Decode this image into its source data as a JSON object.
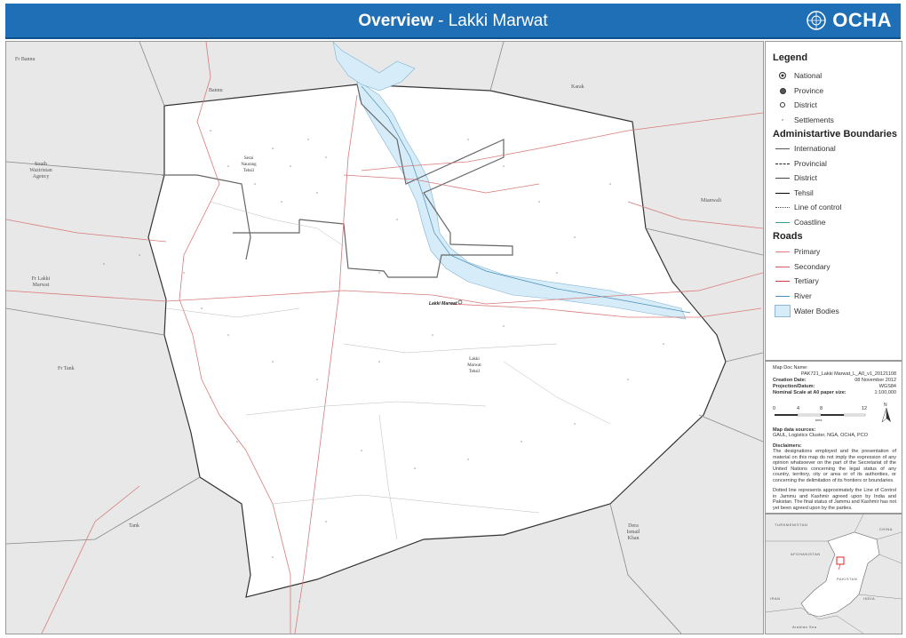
{
  "header": {
    "title_bold": "Overview",
    "title_sep": " - ",
    "title_rest": "Lakki Marwat",
    "logo_text": "OCHA"
  },
  "map": {
    "region_labels": [
      {
        "id": "fr-bannu",
        "text": "Fr Bannu"
      },
      {
        "id": "bannu",
        "text": "Bannu"
      },
      {
        "id": "karak",
        "text": "Karak"
      },
      {
        "id": "south-waziristan",
        "text": "South\nWaziristan\nAgency"
      },
      {
        "id": "mianwali",
        "text": "Mianwali"
      },
      {
        "id": "fr-lakki",
        "text": "Fr Lakki\nMarwat"
      },
      {
        "id": "fr-tank",
        "text": "Fr Tank"
      },
      {
        "id": "tank",
        "text": "Tank"
      },
      {
        "id": "dera-ismail-khan",
        "text": "Dera\nIsmail\nKhan"
      }
    ],
    "tehsil_labels": [
      {
        "id": "serai-naurang",
        "text": "Serai\nNaurang\nTehsil"
      },
      {
        "id": "lakki-marwat-tehsil",
        "text": "Lakki\nMarwat\nTehsil"
      }
    ],
    "district_capital": "Lakki Marwat"
  },
  "legend": {
    "title": "Legend",
    "settlements": [
      {
        "label": "National",
        "symbol": "national"
      },
      {
        "label": "Province",
        "symbol": "province"
      },
      {
        "label": "District",
        "symbol": "district"
      },
      {
        "label": "Settlements",
        "symbol": "settlement"
      }
    ],
    "boundaries_title": "Administartive Boundaries",
    "boundaries": [
      {
        "label": "International",
        "style": "solid-grey"
      },
      {
        "label": "Provincial",
        "style": "dashed"
      },
      {
        "label": "District",
        "style": "solid-dark"
      },
      {
        "label": "Tehsil",
        "style": "solid-black"
      },
      {
        "label": "Line of control",
        "style": "dotted"
      },
      {
        "label": "Coastline",
        "style": "teal"
      }
    ],
    "roads_title": "Roads",
    "roads": [
      {
        "label": "Primary",
        "color": "#e08080"
      },
      {
        "label": "Secondary",
        "color": "#d06060"
      },
      {
        "label": "Tertiary",
        "color": "#c84040"
      },
      {
        "label": "River",
        "color": "#4a8fb8"
      },
      {
        "label": "Water Bodies",
        "color": "#d6ecf8"
      }
    ]
  },
  "info": {
    "map_doc_name_label": "Map Doc Name:",
    "map_doc_name": "PAK721_Lakki Marwat_L_A0_v1_20121108",
    "creation_date_label": "Creation Date:",
    "creation_date": "08 November 2012",
    "projection_label": "Projection/Datum:",
    "projection": "WGS84",
    "scale_label": "Nominal Scale at A0 paper size:",
    "scale": "1:100,000",
    "scale_ticks": [
      "0",
      "4",
      "8",
      "12"
    ],
    "scale_unit": "kms",
    "north": "N",
    "sources_label": "Map data sources:",
    "sources": "GAUL, Logistics Cluster, NGA, OCHA, PCO",
    "disclaimers_label": "Disclaimers:",
    "disclaimer_1": "The designations employed and the presentation of material on this map do not imply the expression of any opinion whatsoever on the part of the Secretariat of the United Nations concerning the legal status of any country, territory, city or area or of its authorities, or concerning the delimitation of its frontiers or boundaries.",
    "disclaimer_2": "Dotted line represents approximately the Line of Control in Jammu and Kashmir agreed upon by India and Pakistan. The final status of Jammu and Kashmir has not yet been agreed upon by the parties."
  },
  "inset": {
    "labels": [
      "TURKMENISTAN",
      "CHINA",
      "AFGHANISTAN",
      "PAKISTAN",
      "INDIA",
      "IRAN",
      "Arabian Sea"
    ]
  },
  "colors": {
    "header_bg": "#1f6fb6",
    "district_fill": "#ffffff",
    "outside_fill": "#e8e8e8",
    "water": "#d6ecf8",
    "road": "#d77a7a",
    "boundary": "#555555",
    "highlight": "#e02020"
  }
}
